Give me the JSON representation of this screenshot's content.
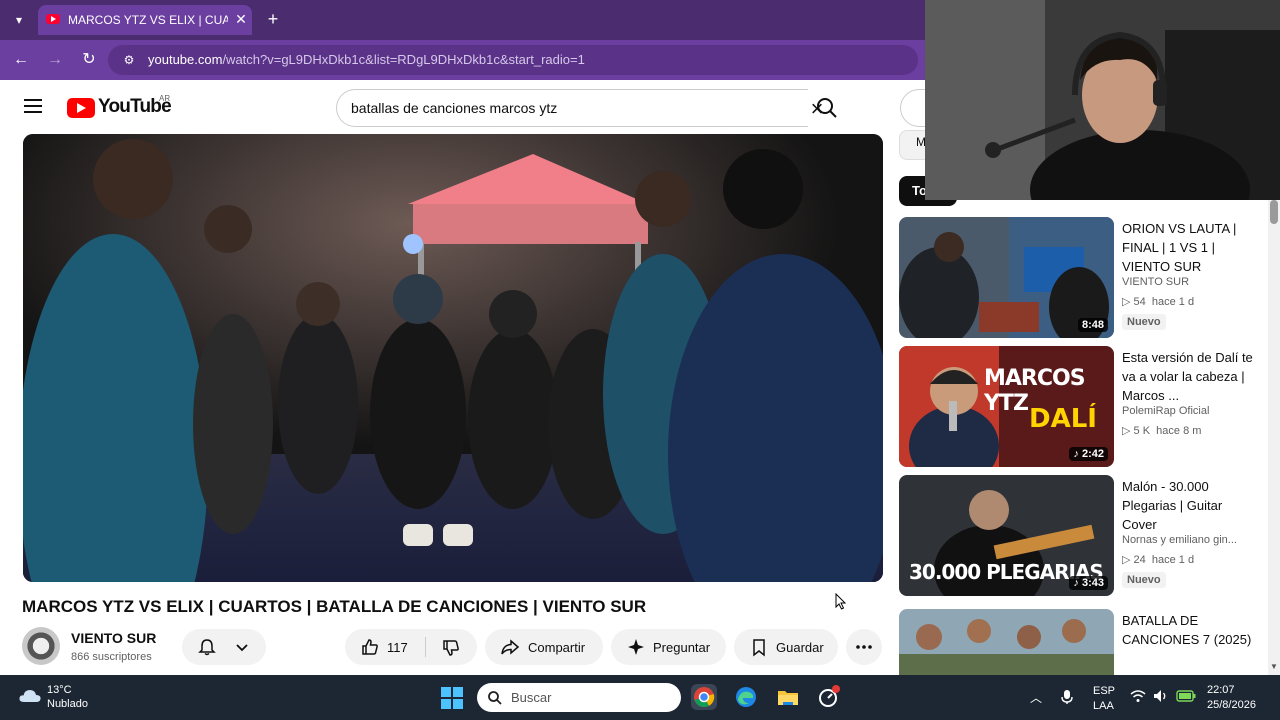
{
  "browser": {
    "tab_title": "MARCOS YTZ VS ELIX | CUARTOS",
    "url_host": "youtube.com",
    "url_path": "/watch?v=gL9DHxDkb1c&list=RDgL9DHxDkb1c&start_radio=1"
  },
  "youtube": {
    "logo_text": "YouTube",
    "country_code": "AR",
    "search_query": "batallas de canciones marcos ytz",
    "header_chip_initial": "",
    "video": {
      "title": "MARCOS YTZ VS ELIX | CUARTOS | BATALLA DE CANCIONES | VIENTO SUR",
      "channel_name": "VIENTO SUR",
      "subscribers": "866 suscriptores",
      "likes": "117",
      "share_label": "Compartir",
      "ask_label": "Preguntar",
      "save_label": "Guardar"
    },
    "sidebar": {
      "top_chip_label": "M",
      "filter_chip": "To",
      "recommendations": [
        {
          "title": "ORION VS LAUTA | FINAL | 1 VS 1 | VIENTO SUR",
          "channel": "VIENTO SUR",
          "views": "54",
          "age": "hace 1 d",
          "duration": "8:48",
          "badge": "Nuevo",
          "shorts": false
        },
        {
          "title": "Esta versión de Dalí te va a volar la cabeza | Marcos ...",
          "channel": "PolemiRap Oficial",
          "views": "5 K",
          "age": "hace 8 m",
          "duration": "2:42",
          "badge": "",
          "shorts": true,
          "thumb_text_1": "MARCOS YTZ",
          "thumb_text_2": "DALÍ"
        },
        {
          "title": "Malón - 30.000 Plegarias | Guitar Cover",
          "channel": "Nornas  y emiliano gin...",
          "views": "24",
          "age": "hace 1 d",
          "duration": "3:43",
          "badge": "Nuevo",
          "shorts": true,
          "thumb_text_1": "30.000 PLEGARIAS"
        },
        {
          "title": "BATALLA DE CANCIONES 7 (2025)",
          "channel": "",
          "views": "",
          "age": "",
          "duration": "",
          "badge": "",
          "shorts": false
        }
      ]
    }
  },
  "taskbar": {
    "temperature": "13°C",
    "weather": "Nublado",
    "search_placeholder": "Buscar",
    "lang_line1": "ESP",
    "lang_line2": "LAA",
    "time": "22:07",
    "date": "25/8/2026"
  },
  "colors": {
    "tabbar": "#4b2c6e",
    "toolbar": "#6b3fa0",
    "youtube_red": "#ff0000",
    "taskbar": "#1c2733"
  }
}
